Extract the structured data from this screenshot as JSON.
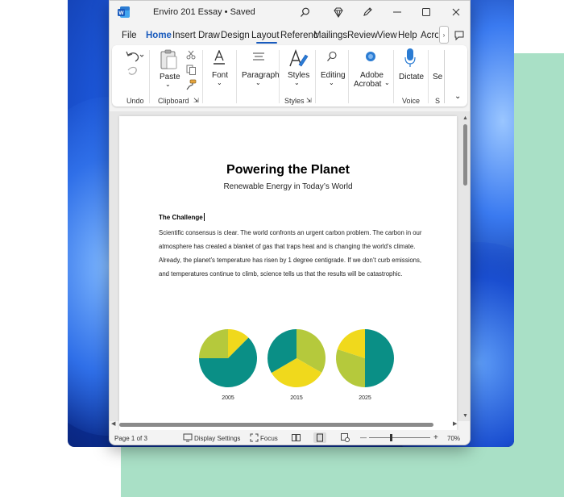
{
  "window": {
    "title": "Enviro 201 Essay • Saved"
  },
  "menu_tabs": [
    "File",
    "Home",
    "Insert",
    "Draw",
    "Design",
    "Layout",
    "Referenc",
    "Mailings",
    "Review",
    "View",
    "Help",
    "Acrob"
  ],
  "active_tab": "Home",
  "ribbon": {
    "paste_label": "Paste",
    "font_label": "Font",
    "paragraph_label": "Paragraph",
    "styles_label": "Styles",
    "editing_label": "Editing",
    "adobe_label_1": "Adobe",
    "adobe_label_2": "Acrobat",
    "dictate_label": "Dictate",
    "se_label": "Se",
    "groups": {
      "undo": "Undo",
      "clipboard": "Clipboard",
      "styles": "Styles",
      "voice": "Voice",
      "s": "S"
    }
  },
  "document": {
    "title": "Powering the Planet",
    "subtitle": "Renewable Energy in Today’s World",
    "heading": "The Challenge",
    "paragraph": "Scientific consensus is clear. The world confronts an urgent carbon problem. The carbon in our atmosphere has created a blanket of gas that traps heat and is changing the world’s climate. Already, the planet’s temperature has risen by 1 degree centigrade. If we don’t curb emissions, and temperatures continue to climb, science tells us that the results will be catastrophic."
  },
  "chart_data": [
    {
      "type": "pie",
      "title": "2005",
      "colors": [
        "#f0d91c",
        "#0a8f86",
        "#b5c93c"
      ],
      "values": [
        0.125,
        0.625,
        0.25
      ]
    },
    {
      "type": "pie",
      "title": "2015",
      "colors": [
        "#b5c93c",
        "#f0d91c",
        "#0a8f86"
      ],
      "values": [
        0.333,
        0.333,
        0.334
      ]
    },
    {
      "type": "pie",
      "title": "2025",
      "colors": [
        "#0a8f86",
        "#b5c93c",
        "#f0d91c"
      ],
      "values": [
        0.5,
        0.3,
        0.2
      ]
    }
  ],
  "status_bar": {
    "page": "Page 1 of 3",
    "display_settings": "Display Settings",
    "focus": "Focus",
    "zoom_minus": "—",
    "zoom_plus": "+",
    "zoom": "70%"
  },
  "colors": {
    "accent": "#185abd",
    "pie_teal": "#0a8f86",
    "pie_yellow": "#f0d91c",
    "pie_olive": "#b5c93c"
  }
}
